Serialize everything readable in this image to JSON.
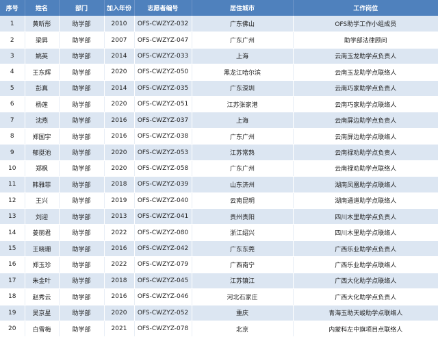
{
  "table": {
    "columns": [
      "序号",
      "姓名",
      "部门",
      "加入年份",
      "志愿者编号",
      "居住城市",
      "工作岗位"
    ],
    "rows": [
      [
        "1",
        "黄昕彤",
        "助学部",
        "2010",
        "OFS-CWZYZ-032",
        "广东佛山",
        "OFS助学工作小组成员"
      ],
      [
        "2",
        "梁昇",
        "助学部",
        "2007",
        "OFS-CWZYZ-047",
        "广东广州",
        "助学部法律顾问"
      ],
      [
        "3",
        "姚英",
        "助学部",
        "2014",
        "OFS-CWZYZ-033",
        "上海",
        "云南玉龙助学点负责人"
      ],
      [
        "4",
        "王东辉",
        "助学部",
        "2020",
        "OFS-CWZYZ-050",
        "黑龙江哈尔滨",
        "云南玉龙助学点联络人"
      ],
      [
        "5",
        "彭真",
        "助学部",
        "2014",
        "OFS-CWZYZ-035",
        "广东深圳",
        "云南巧家助学点负责人"
      ],
      [
        "6",
        "杨莲",
        "助学部",
        "2020",
        "OFS-CWZYZ-051",
        "江苏张家港",
        "云南巧家助学点联络人"
      ],
      [
        "7",
        "沈燕",
        "助学部",
        "2016",
        "OFS-CWZYZ-037",
        "上海",
        "云南屏边助学点负责人"
      ],
      [
        "8",
        "郑国宇",
        "助学部",
        "2016",
        "OFS-CWZYZ-038",
        "广东广州",
        "云南屏边助学点联络人"
      ],
      [
        "9",
        "郁挺池",
        "助学部",
        "2020",
        "OFS-CWZYZ-053",
        "江苏常熟",
        "云南禄劝助学点负责人"
      ],
      [
        "10",
        "郑枫",
        "助学部",
        "2020",
        "OFS-CWZYZ-058",
        "广东广州",
        "云南禄劝助学点联络人"
      ],
      [
        "11",
        "韩雅菲",
        "助学部",
        "2018",
        "OFS-CWZYZ-039",
        "山东济州",
        "湖南凤凰助学点联络人"
      ],
      [
        "12",
        "王兴",
        "助学部",
        "2019",
        "OFS-CWZYZ-040",
        "云南昆明",
        "湖南通道助学点联络人"
      ],
      [
        "13",
        "刘迎",
        "助学部",
        "2013",
        "OFS-CWZYZ-041",
        "贵州贵阳",
        "四川木里助学点负责人"
      ],
      [
        "14",
        "姜丽君",
        "助学部",
        "2022",
        "OFS-CWZYZ-080",
        "浙江绍兴",
        "四川木里助学点联络人"
      ],
      [
        "15",
        "王晓珊",
        "助学部",
        "2016",
        "OFS-CWZYZ-042",
        "广东东莞",
        "广西乐业助学点负责人"
      ],
      [
        "16",
        "郑玉珍",
        "助学部",
        "2022",
        "OFS-CWZYZ-079",
        "广西南宁",
        "广西乐业助学点联络人"
      ],
      [
        "17",
        "朱金叶",
        "助学部",
        "2018",
        "OFS-CWZYZ-045",
        "江苏镇江",
        "广西大化助学点联络人"
      ],
      [
        "18",
        "赵秀云",
        "助学部",
        "2016",
        "OFS-CWZYZ-046",
        "河北石家庄",
        "广西大化助学点负责人"
      ],
      [
        "19",
        "吴京星",
        "助学部",
        "2020",
        "OFS-CWZYZ-052",
        "重庆",
        "青海玉助天峻助学点联络人"
      ],
      [
        "20",
        "白雪梅",
        "助学部",
        "2021",
        "OFS-CWZYZ-078",
        "北京",
        "内蒙科左中旗项目点联络人"
      ]
    ]
  },
  "colors": {
    "header_bg": "#4f81bd",
    "header_text": "#ffffff",
    "stripe_bg": "#dce6f2",
    "row_bg": "#ffffff"
  }
}
